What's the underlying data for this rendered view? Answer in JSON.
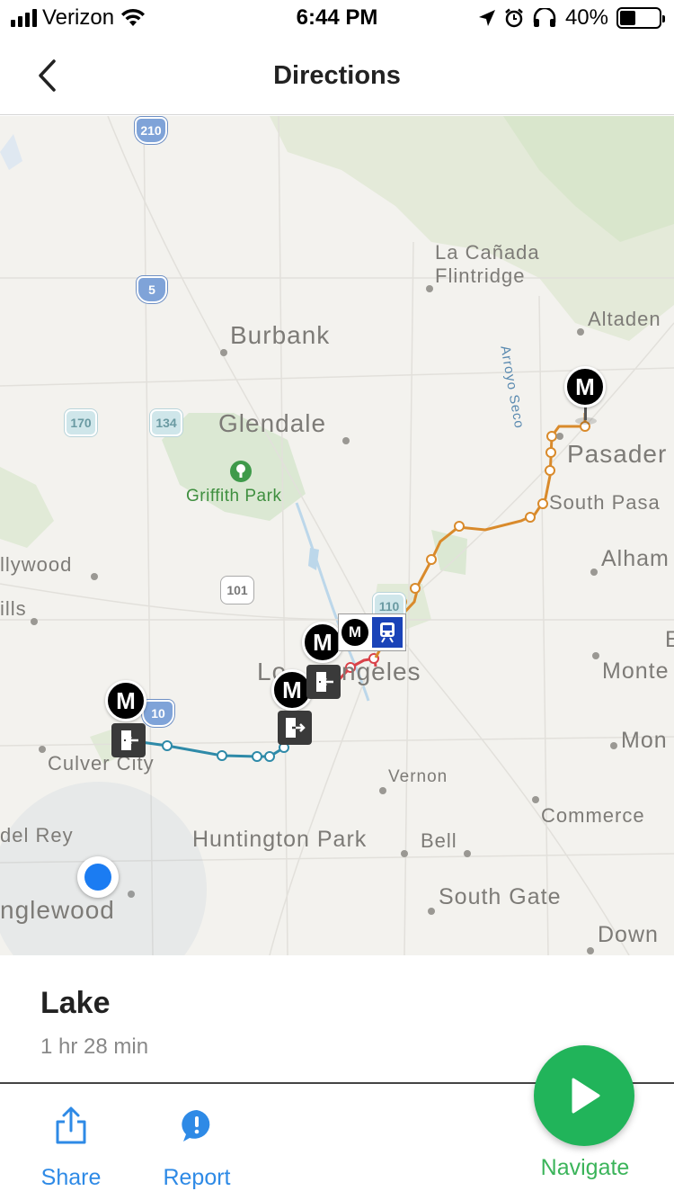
{
  "status_bar": {
    "carrier": "Verizon",
    "time": "6:44 PM",
    "battery_percent": "40%",
    "battery_level": 0.4,
    "icons": [
      "signal-icon",
      "wifi-icon",
      "location-arrow-icon",
      "alarm-icon",
      "headphones-icon",
      "battery-icon"
    ]
  },
  "nav": {
    "title": "Directions",
    "back_icon": "chevron-left-icon"
  },
  "map": {
    "places": {
      "la_canada": "La Cañada",
      "flintridge": "Flintridge",
      "altadena": "Altaden",
      "burbank": "Burbank",
      "arroyo_seco": "Arroyo Seco",
      "glendale": "Glendale",
      "pasadena": "Pasader",
      "griffith_park": "Griffith Park",
      "south_pasadena": "South Pasa",
      "hollywood": "llywood",
      "alhambra": "Alham",
      "hills": "ills",
      "los_angeles_left": "Lo",
      "los_angeles_right": "ngeles",
      "e_cut": "E",
      "montebello": "Monte",
      "culver_city": "Culver City",
      "monterey": "Mon",
      "vernon": "Vernon",
      "marina_del_rey": "del Rey",
      "commerce": "Commerce",
      "huntington_park": "Huntington Park",
      "bell": "Bell",
      "south_gate": "South Gate",
      "inglewood": "nglewood",
      "downey": "Down"
    },
    "shields": {
      "i210": "210",
      "i5": "5",
      "ca170": "170",
      "ca134": "134",
      "us101": "101",
      "ca110": "110",
      "i10": "10"
    },
    "metro_marker_letter": "M",
    "icons": [
      "metro-marker-icon",
      "enter-station-icon",
      "exit-station-icon",
      "train-icon",
      "park-tree-icon",
      "current-location-icon"
    ],
    "colors": {
      "gold_line": "#d98a2b",
      "red_line": "#d9434a",
      "expo_line": "#2e8aa8",
      "user_location": "#1b7cf2"
    }
  },
  "route": {
    "name": "Lake",
    "duration": "1 hr 28 min"
  },
  "toolbar": {
    "share_label": "Share",
    "report_label": "Report",
    "navigate_label": "Navigate",
    "accent": "#2e8ae6",
    "navigate_color": "#21b45a"
  }
}
